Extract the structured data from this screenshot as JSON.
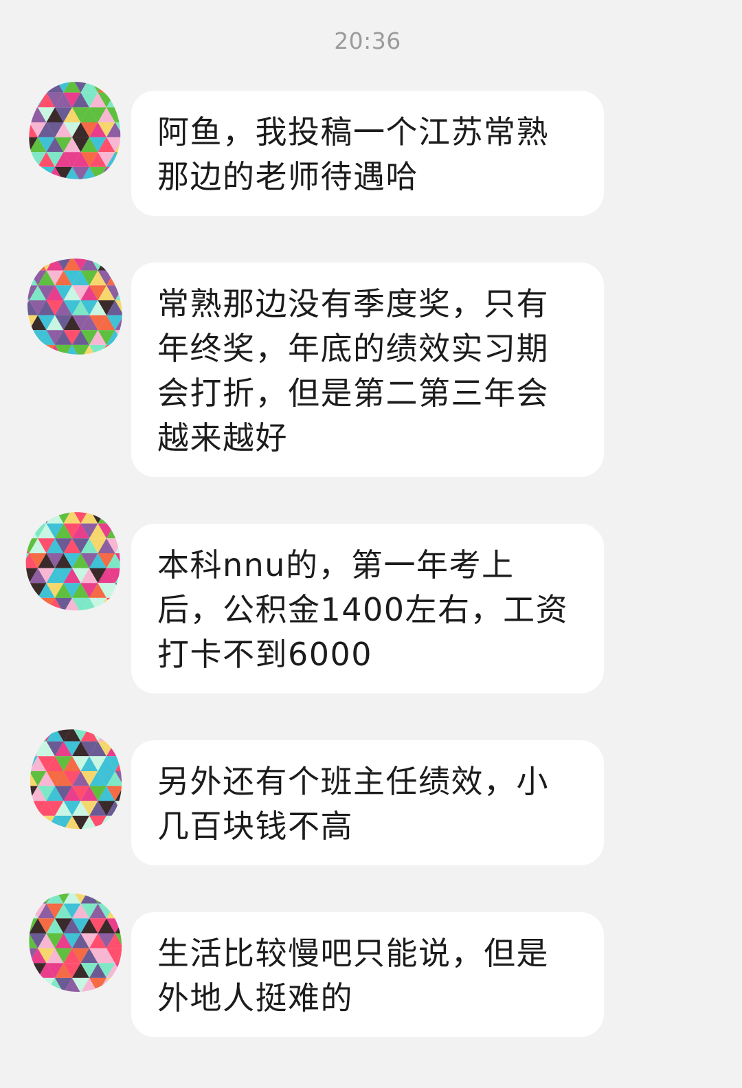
{
  "chat": {
    "timestamp": "20:36",
    "messages": [
      {
        "sender_avatar": "mosaic-avatar",
        "text": "阿鱼，我投稿一个江苏常熟那边的老师待遇哈"
      },
      {
        "sender_avatar": "mosaic-avatar",
        "text": "常熟那边没有季度奖，只有年终奖，年底的绩效实习期会打折，但是第二第三年会越来越好"
      },
      {
        "sender_avatar": "mosaic-avatar",
        "text": "本科nnu的，第一年考上后，公积金1400左右，工资打卡不到6000"
      },
      {
        "sender_avatar": "mosaic-avatar",
        "text": "另外还有个班主任绩效，小几百块钱不高"
      },
      {
        "sender_avatar": "mosaic-avatar",
        "text": "生活比较慢吧只能说，但是外地人挺难的"
      }
    ]
  },
  "colors": {
    "background": "#f2f2f2",
    "bubble": "#ffffff",
    "text": "#1c1c1c",
    "timestamp": "#9b9b9b",
    "avatar_palette": [
      "#e83e8c",
      "#3fc1d6",
      "#7ee8c6",
      "#f5d76e",
      "#8e5ea2",
      "#5fbf3f",
      "#f46b45",
      "#3a2a2a",
      "#c9f5e3",
      "#ff4f6d",
      "#f7b7d2",
      "#6b5b95"
    ]
  }
}
